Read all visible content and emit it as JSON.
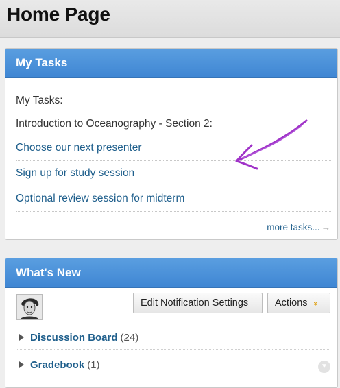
{
  "page": {
    "title": "Home Page"
  },
  "my_tasks": {
    "title": "My Tasks",
    "label": "My Tasks:",
    "course": "Introduction to Oceanography - Section 2:",
    "tasks": [
      {
        "label": "Choose our next presenter"
      },
      {
        "label": "Sign up for study session"
      },
      {
        "label": "Optional review session for midterm"
      }
    ],
    "more_link": "more tasks...",
    "more_arrow": "→"
  },
  "whats_new": {
    "title": "What's New",
    "notification_button": "Edit Notification Settings",
    "actions_button": "Actions",
    "actions_chevron": "»",
    "items": [
      {
        "name": "Discussion Board",
        "count": "(24)"
      },
      {
        "name": "Gradebook",
        "count": "(1)"
      }
    ]
  },
  "colors": {
    "module_header": "#4a91db",
    "link": "#1f5f8c",
    "annotation_arrow": "#a033c8",
    "actions_chevron": "#e0a520"
  },
  "icons": {
    "annotation": "hand-drawn-arrow-icon",
    "expand": "triangle-right-icon",
    "scroll": "chevron-down-icon"
  }
}
